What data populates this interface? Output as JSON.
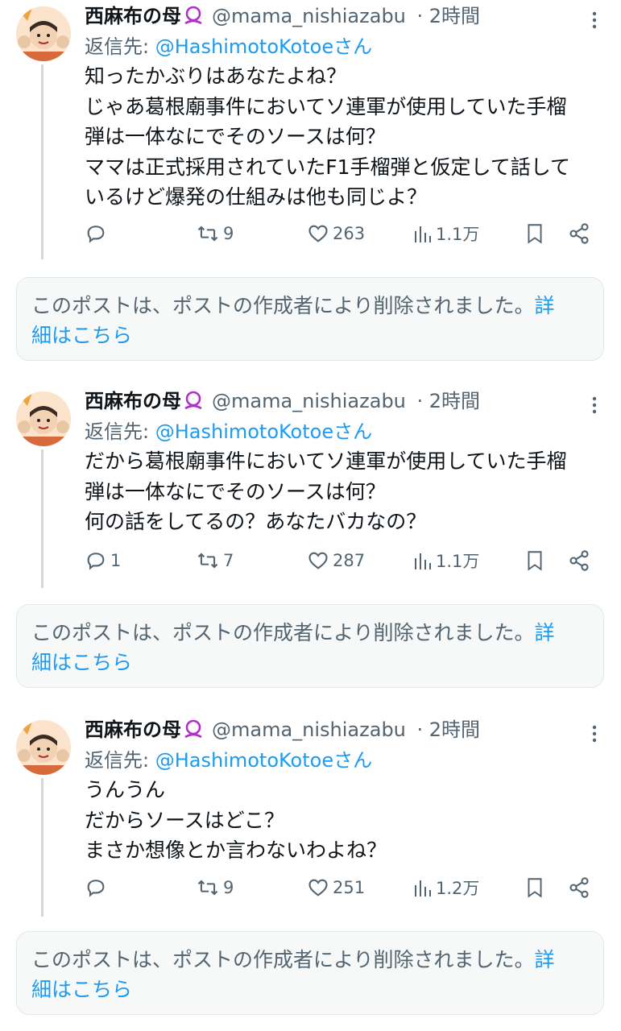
{
  "colors": {
    "accent": "#1d9bf0",
    "secondary_text": "#536471",
    "primary_text": "#0f1419"
  },
  "tweets": [
    {
      "name": "西麻布の母",
      "handle": "@mama_nishiazabu",
      "time": "· 2時間",
      "reply_prefix": "返信先: ",
      "reply_target": "@HashimotoKotoeさん",
      "lines": [
        "知ったかぶりはあなたよね？",
        "じゃあ葛根廟事件においてソ連軍が使用していた手榴",
        "弾は一体なにでそのソースは何？",
        "ママは正式採用されていたF1手榴弾と仮定して話して",
        "いるけど爆発の仕組みは他も同じよ？"
      ],
      "replies": "",
      "reposts": "9",
      "likes": "263",
      "views": "1.1万"
    },
    {
      "name": "西麻布の母",
      "handle": "@mama_nishiazabu",
      "time": "· 2時間",
      "reply_prefix": "返信先: ",
      "reply_target": "@HashimotoKotoeさん",
      "lines": [
        "だから葛根廟事件においてソ連軍が使用していた手榴",
        "弾は一体なにでそのソースは何？",
        "何の話をしてるの？あなたバカなの？"
      ],
      "replies": "1",
      "reposts": "7",
      "likes": "287",
      "views": "1.1万"
    },
    {
      "name": "西麻布の母",
      "handle": "@mama_nishiazabu",
      "time": "· 2時間",
      "reply_prefix": "返信先: ",
      "reply_target": "@HashimotoKotoeさん",
      "lines": [
        "うんうん",
        "だからソースはどこ？",
        "まさか想像とか言わないわよね？"
      ],
      "replies": "",
      "reposts": "9",
      "likes": "251",
      "views": "1.2万"
    }
  ],
  "deleted_notice": {
    "line1": "このポストは、ポストの作成者により削除されました。",
    "more_a": "詳",
    "more_b": "細はこちら"
  }
}
